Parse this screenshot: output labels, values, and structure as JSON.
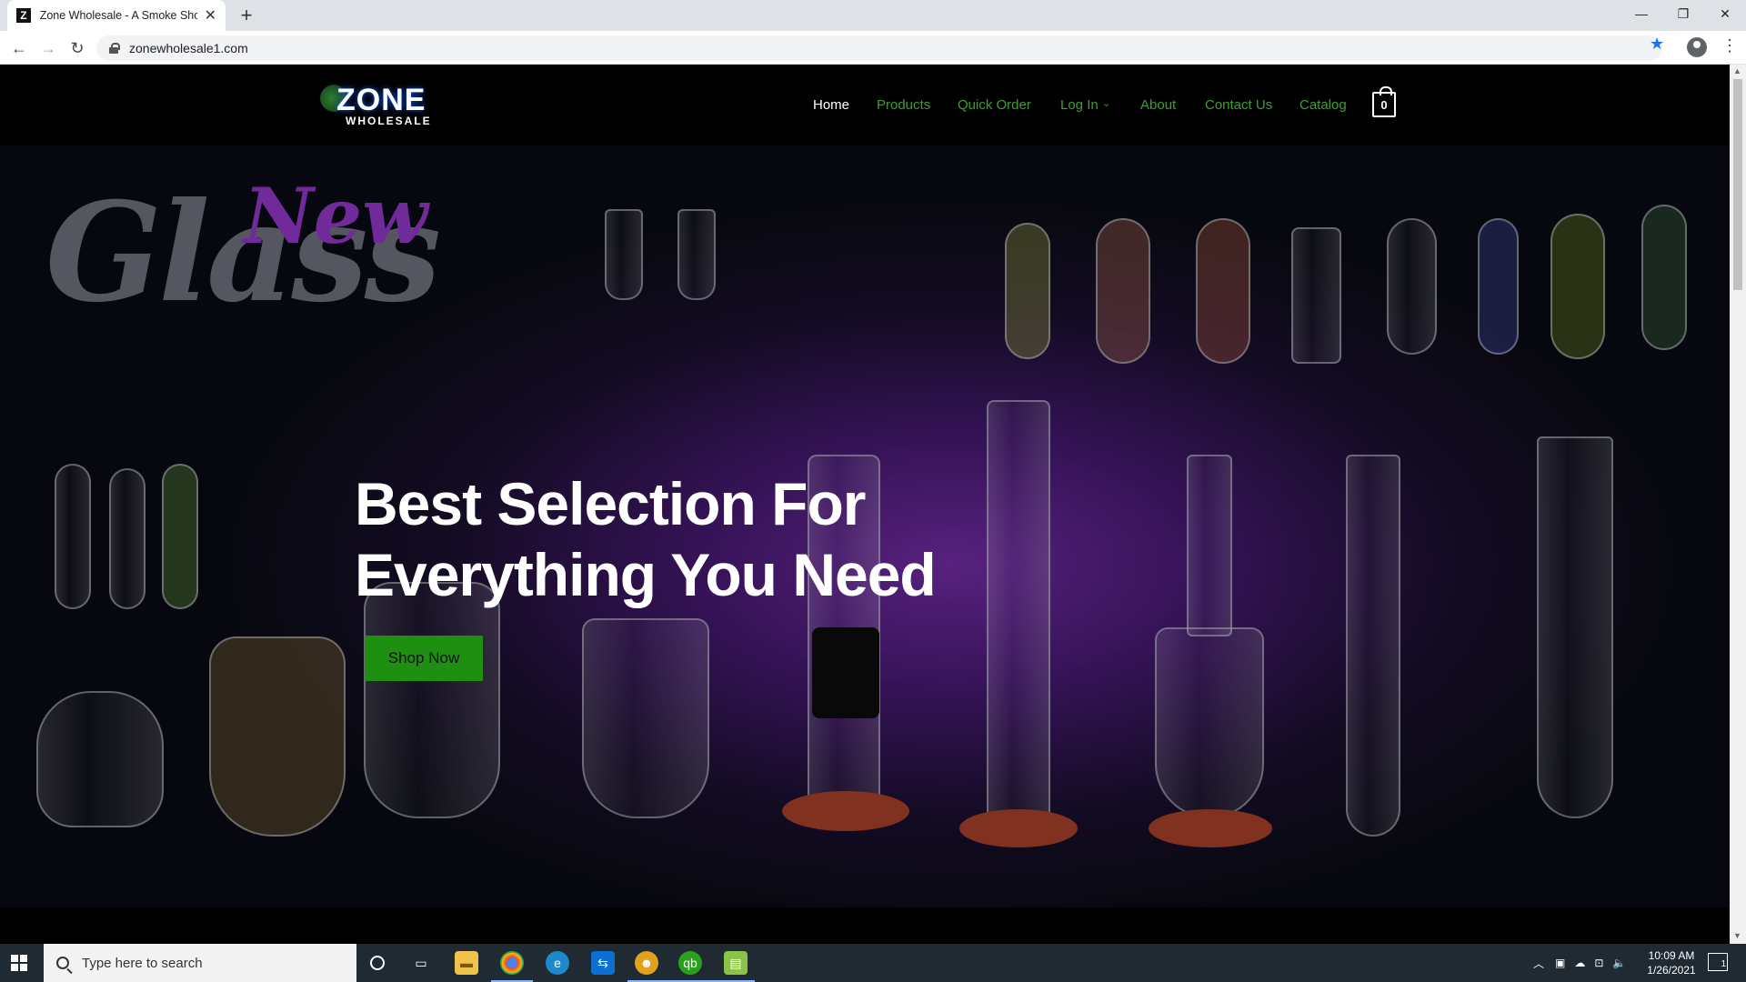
{
  "browser": {
    "tab_title": "Zone Wholesale - A Smoke Shop",
    "tab_favicon": "Z",
    "url": "zonewholesale1.com"
  },
  "site": {
    "logo_main": "ZONE",
    "logo_sub": "WHOLESALE",
    "nav": [
      "Home",
      "Products",
      "Quick Order",
      "Log In",
      "About",
      "Contact Us",
      "Catalog"
    ],
    "cart_count": "0"
  },
  "hero": {
    "deco_title": "Glass",
    "deco_new": "New",
    "headline_line1": "Best Selection For",
    "headline_line2": "Everything You Need",
    "cta": "Shop Now"
  },
  "taskbar": {
    "search_placeholder": "Type here to search",
    "time": "10:09 AM",
    "date": "1/26/2021",
    "notification_count": "1"
  },
  "colors": {
    "nav_link": "#3aa12b",
    "cta_bg": "#1f8f12",
    "hero_glow": "#7a2fb0"
  }
}
